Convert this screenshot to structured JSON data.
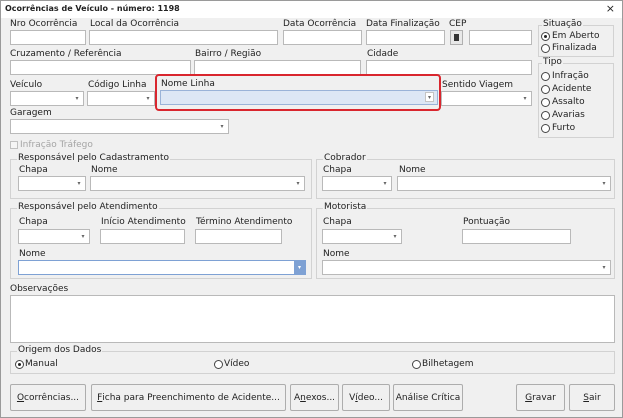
{
  "window": {
    "title": "Ocorrências de Veículo - número: 1198",
    "close_glyph": "×"
  },
  "fields": {
    "nro_ocorrencia": "Nro Ocorrência",
    "local": "Local da Ocorrência",
    "data_ocorrencia": "Data Ocorrência",
    "data_finalizacao": "Data Finalização",
    "cep": "CEP",
    "cruzamento": "Cruzamento / Referência",
    "bairro": "Bairro / Região",
    "cidade": "Cidade",
    "veiculo": "Veículo",
    "codigo_linha": "Código Linha",
    "nome_linha": "Nome Linha",
    "sentido_viagem": "Sentido Viagem",
    "garagem": "Garagem",
    "infracao_trafego": "Infração Tráfego"
  },
  "situacao": {
    "title": "Situação",
    "options": [
      "Em Aberto",
      "Finalizada"
    ],
    "selected": 0
  },
  "tipo": {
    "title": "Tipo",
    "options": [
      "Infração",
      "Acidente",
      "Assalto",
      "Avarias",
      "Furto"
    ]
  },
  "cadastramento": {
    "title": "Responsável pelo Cadastramento",
    "chapa": "Chapa",
    "nome": "Nome"
  },
  "cobrador": {
    "title": "Cobrador",
    "chapa": "Chapa",
    "nome": "Nome"
  },
  "atendimento": {
    "title": "Responsável pelo Atendimento",
    "chapa": "Chapa",
    "inicio": "Início Atendimento",
    "termino": "Término Atendimento",
    "nome": "Nome"
  },
  "motorista": {
    "title": "Motorista",
    "chapa": "Chapa",
    "pontuacao": "Pontuação",
    "nome": "Nome"
  },
  "observacoes": "Observações",
  "origem": {
    "title": "Origem dos Dados",
    "options": [
      "Manual",
      "Vídeo",
      "Bilhetagem"
    ],
    "selected": 0
  },
  "buttons": {
    "ocorrencias": {
      "pre": "",
      "u": "O",
      "post": "corrências..."
    },
    "ficha": {
      "pre": "",
      "u": "F",
      "post": "icha para Preenchimento de Acidente..."
    },
    "anexos": {
      "pre": "A",
      "u": "n",
      "post": "exos..."
    },
    "video": {
      "pre": "V",
      "u": "í",
      "post": "deo..."
    },
    "analise": {
      "pre": "Análise Crítica",
      "u": "",
      "post": ""
    },
    "gravar": {
      "pre": "",
      "u": "G",
      "post": "ravar"
    },
    "sair": {
      "pre": "",
      "u": "S",
      "post": "air"
    }
  },
  "icons": {
    "dropdown": "▾",
    "cep_lookup": "cep-lookup-icon"
  }
}
